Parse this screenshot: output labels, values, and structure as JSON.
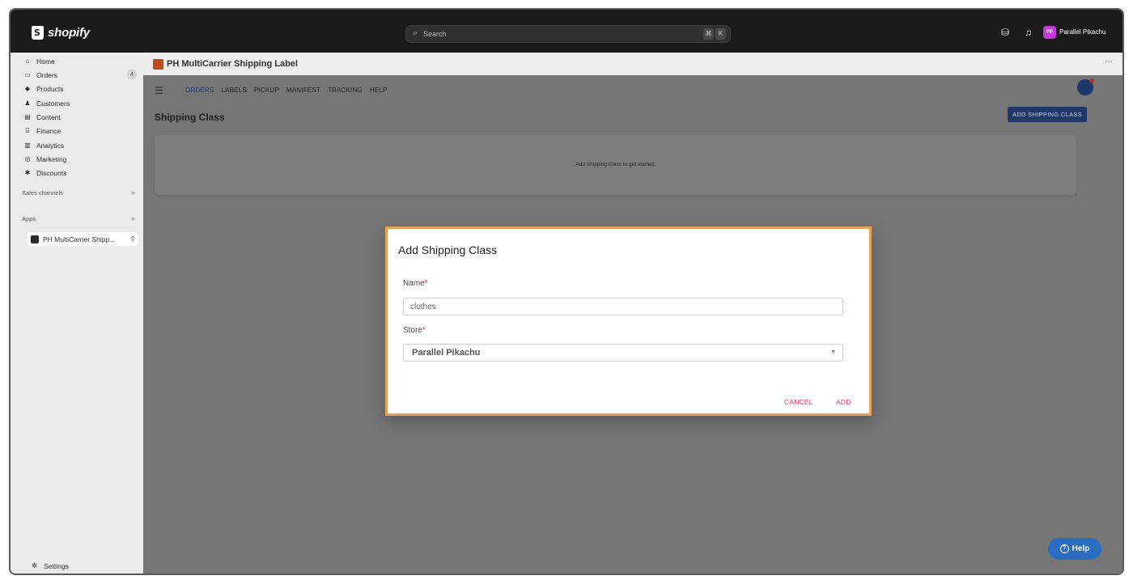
{
  "topbar": {
    "brand": "shopify",
    "search_placeholder": "Search",
    "shortcut_key1": "⌘",
    "shortcut_key2": "K",
    "user_initials": "PP",
    "user_name": "Parallel Pikachu"
  },
  "sidebar": {
    "items": [
      {
        "label": "Home",
        "icon": "home-icon"
      },
      {
        "label": "Orders",
        "icon": "orders-icon",
        "badge": "4"
      },
      {
        "label": "Products",
        "icon": "tag-icon"
      },
      {
        "label": "Customers",
        "icon": "person-icon"
      },
      {
        "label": "Content",
        "icon": "content-icon"
      },
      {
        "label": "Finance",
        "icon": "bank-icon"
      },
      {
        "label": "Analytics",
        "icon": "chart-icon"
      },
      {
        "label": "Marketing",
        "icon": "target-icon"
      },
      {
        "label": "Discounts",
        "icon": "gear-icon"
      }
    ],
    "sales_channels": "Sales channels",
    "apps": "Apps",
    "app_item": "PH MultiCarrier Shipp...",
    "settings": "Settings"
  },
  "app": {
    "title": "PH MultiCarrier Shipping Label",
    "more": "···",
    "tabs": [
      "ORDERS",
      "LABELS",
      "PICKUP",
      "MANIFEST",
      "TRACKING",
      "HELP"
    ],
    "page_title": "Shipping Class",
    "add_button": "ADD SHIPPING CLASS",
    "empty_message": "Add Shipping Class to get started."
  },
  "modal": {
    "title": "Add Shipping Class",
    "name_label": "Name",
    "name_value": "clothes",
    "store_label": "Store",
    "store_value": "Parallel Pikachu",
    "required_mark": "*",
    "cancel": "CANCEL",
    "add": "ADD"
  },
  "help": {
    "label": "Help"
  },
  "colors": {
    "accent_pink": "#e6336b",
    "modal_border": "#e5a35a",
    "nav_blue": "#203865",
    "avatar": "#c23ad8",
    "help_blue": "#2a6dbf"
  }
}
